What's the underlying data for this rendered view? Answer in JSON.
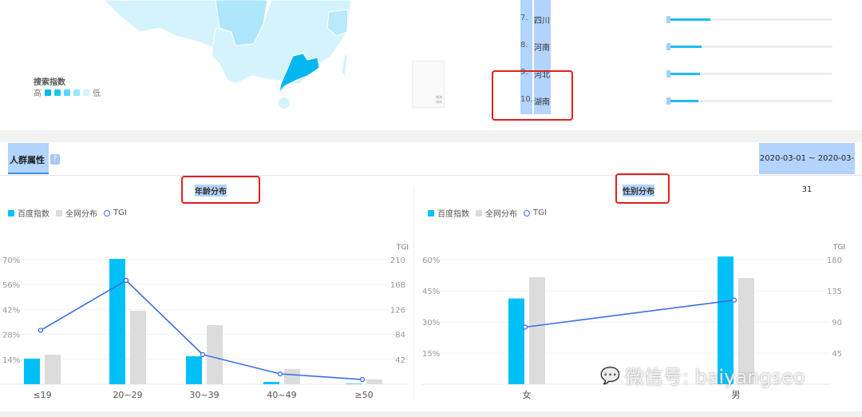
{
  "map": {
    "legend_title": "搜索指数",
    "legend_high": "高",
    "legend_low": "低",
    "legend_colors": [
      "#00b7f0",
      "#1fc3f5",
      "#5dd3f7",
      "#9be3fa",
      "#d3f3fd"
    ],
    "inset_labels": [
      "南海",
      "诸岛"
    ]
  },
  "ranking": {
    "items": [
      {
        "rank": "7.",
        "name": "四川",
        "value": 0.26
      },
      {
        "rank": "8.",
        "name": "河南",
        "value": 0.21
      },
      {
        "rank": "9.",
        "name": "河北",
        "value": 0.2
      },
      {
        "rank": "10.",
        "name": "湖南",
        "value": 0.19
      }
    ]
  },
  "section": {
    "title": "人群属性",
    "help_icon": "?",
    "date_range": "2020-03-01 ~ 2020-03-31"
  },
  "watermark": "微信号: baiyangseo",
  "colors": {
    "baidu": "#00c1f7",
    "all": "#dcdcdc",
    "tgi": "#3a6de8"
  },
  "chart_data": [
    {
      "type": "bar",
      "title": "年龄分布",
      "legend": [
        "百度指数",
        "全网分布",
        "TGI"
      ],
      "categories": [
        "≤19",
        "20~29",
        "30~39",
        "40~49",
        "≥50"
      ],
      "series": [
        {
          "name": "百度指数",
          "values": [
            14.4,
            70.4,
            15.7,
            1.3,
            0.3
          ]
        },
        {
          "name": "全网分布",
          "values": [
            16.6,
            41.3,
            33.2,
            8.5,
            2.7
          ]
        },
        {
          "name": "TGI",
          "type": "line",
          "axis": "right",
          "values": [
            91,
            175,
            50,
            17.5,
            8
          ]
        }
      ],
      "ylim": [
        0,
        70
      ],
      "yticks": [
        "14%",
        "28%",
        "42%",
        "56%",
        "70%"
      ],
      "y2label": "TGI",
      "y2lim": [
        0,
        210
      ],
      "y2ticks": [
        "42",
        "84",
        "126",
        "168",
        "210"
      ],
      "legend_position": "top-left",
      "grid": true
    },
    {
      "type": "bar",
      "title": "性别分布",
      "legend": [
        "百度指数",
        "全网分布",
        "TGI"
      ],
      "categories": [
        "女",
        "男"
      ],
      "series": [
        {
          "name": "百度指数",
          "values": [
            41.3,
            61.5
          ]
        },
        {
          "name": "全网分布",
          "values": [
            51.6,
            51.2
          ]
        },
        {
          "name": "TGI",
          "type": "line",
          "axis": "right",
          "values": [
            82.5,
            121.5
          ]
        }
      ],
      "ylim": [
        0,
        60
      ],
      "yticks": [
        "15%",
        "30%",
        "45%",
        "60%"
      ],
      "y2label": "TGI",
      "y2lim": [
        0,
        180
      ],
      "y2ticks": [
        "45",
        "90",
        "135",
        "180"
      ],
      "legend_position": "top-left",
      "grid": true
    }
  ]
}
